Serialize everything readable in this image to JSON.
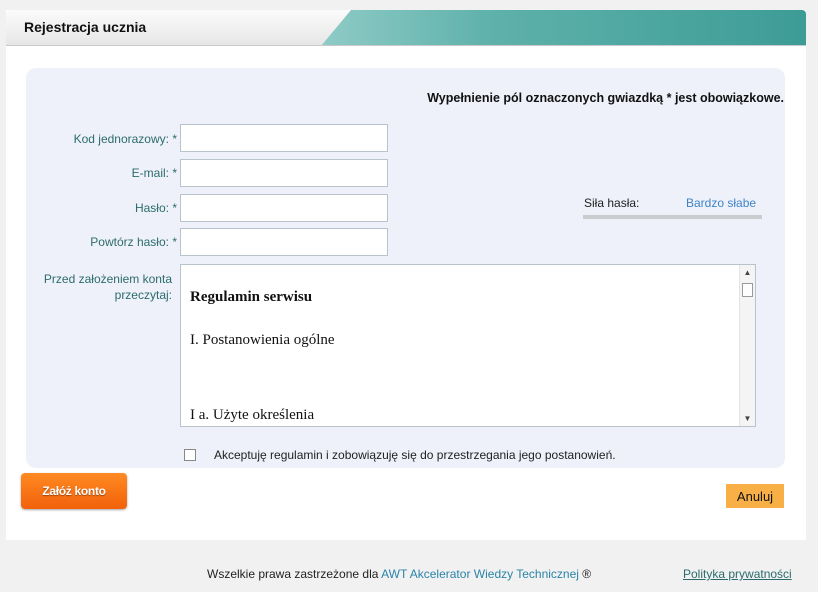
{
  "header": {
    "title": "Rejestracja ucznia"
  },
  "form": {
    "required_note": "Wypełnienie pól oznaczonych gwiazdką * jest obowiązkowe.",
    "fields": [
      {
        "label": "Kod jednorazowy: *",
        "value": ""
      },
      {
        "label": "E-mail: *",
        "value": ""
      },
      {
        "label": "Hasło: *",
        "value": ""
      },
      {
        "label": "Powtórz hasło: *",
        "value": ""
      }
    ],
    "password_strength": {
      "label": "Siła hasła:",
      "value": "Bardzo słabe"
    },
    "regulamin": {
      "label": "Przed założeniem konta przeczytaj:",
      "title": "Regulamin serwisu",
      "section1": "I. Postanowienia ogólne",
      "section2": "I a. Użyte określenia"
    },
    "accept": {
      "label": "Akceptuję regulamin i zobowiązuję się do przestrzegania jego postanowień.",
      "checked": false
    }
  },
  "actions": {
    "submit_label": "Załóż konto",
    "cancel_label": "Anuluj"
  },
  "footer": {
    "rights_text": "Wszelkie prawa zastrzeżone dla",
    "company_link": "AWT Akcelerator Wiedzy Technicznej",
    "registered_mark": "®",
    "privacy_link": "Polityka prywatności"
  },
  "colors": {
    "header_accent": "#4da7a0",
    "panel_bg": "#eef1fa",
    "label_color": "#2c6b6b",
    "strength_value": "#3f84c7",
    "submit_button": "#f46c10",
    "cancel_button": "#f8b046"
  }
}
